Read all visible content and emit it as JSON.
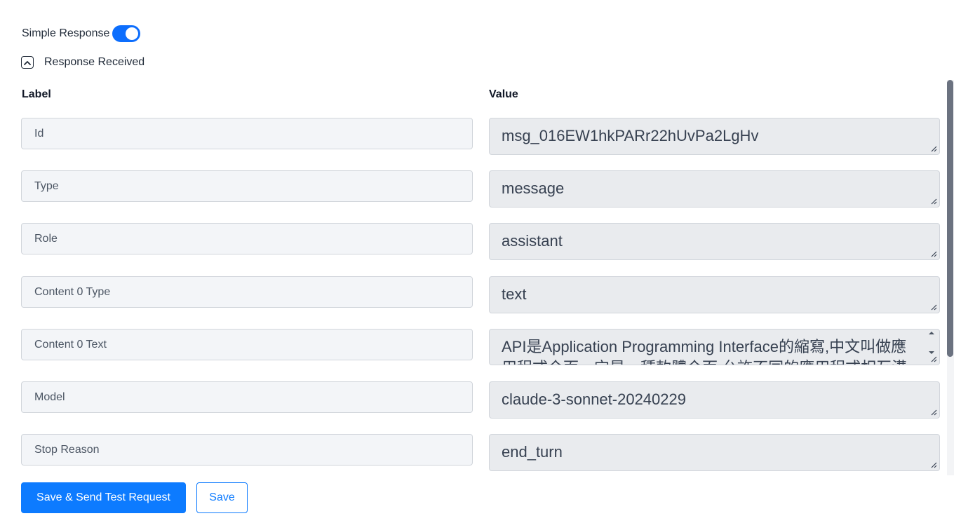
{
  "toggle": {
    "label": "Simple Response",
    "state": "on"
  },
  "section": {
    "title": "Response Received",
    "icon": "chevron-up-icon"
  },
  "columns": {
    "label": "Label",
    "value": "Value"
  },
  "rows": [
    {
      "label": "Id",
      "value": "msg_016EW1hkPARr22hUvPa2LgHv"
    },
    {
      "label": "Type",
      "value": "message"
    },
    {
      "label": "Role",
      "value": "assistant"
    },
    {
      "label": "Content 0 Type",
      "value": "text"
    },
    {
      "label": "Content 0 Text",
      "value": "API是Application Programming Interface的縮寫,中文叫做應用程式介面。它是一種軟體介面,允許不同的應用程式相互溝通。"
    },
    {
      "label": "Model",
      "value": "claude-3-sonnet-20240229"
    },
    {
      "label": "Stop Reason",
      "value": "end_turn"
    }
  ],
  "buttons": {
    "primary": "Save & Send Test Request",
    "secondary": "Save"
  },
  "colors": {
    "accent": "#0d7bff",
    "toggle": "#0d6efd",
    "label_bg": "#f3f5f8",
    "value_bg": "#e9ebee"
  }
}
